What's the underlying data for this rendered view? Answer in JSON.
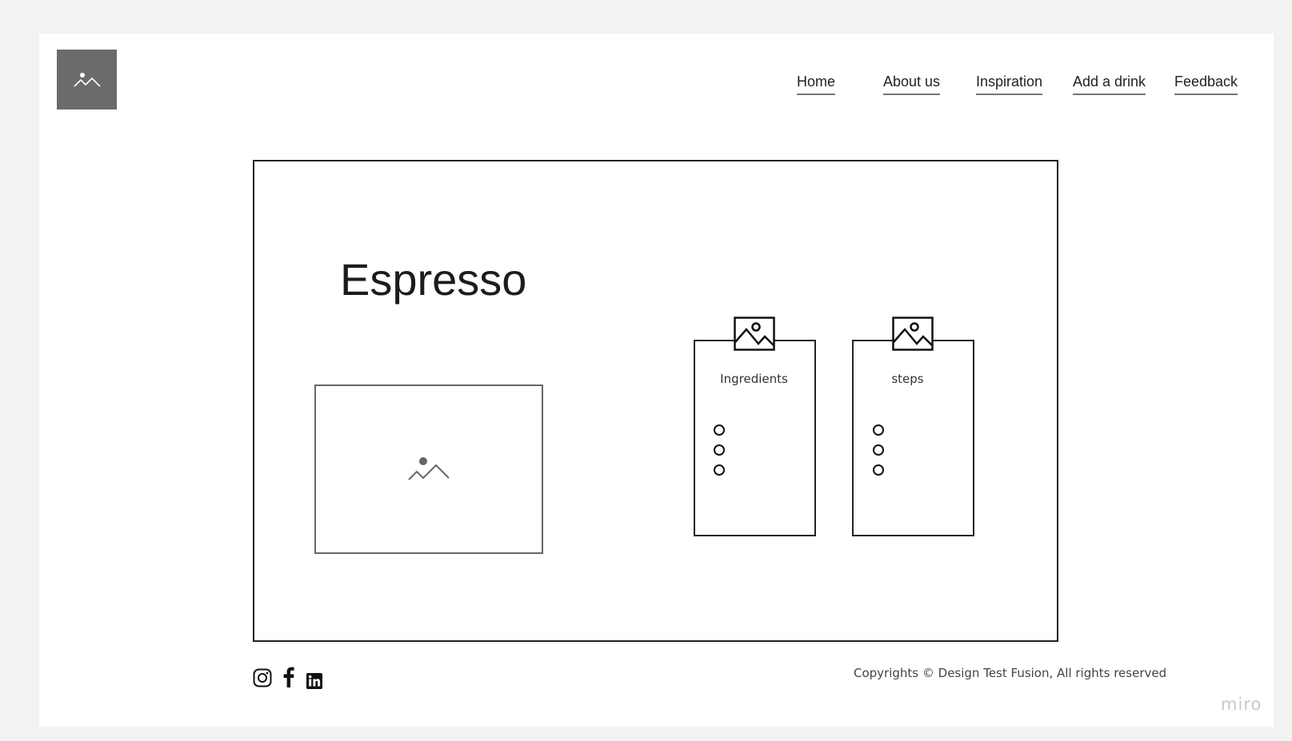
{
  "header": {
    "logo_icon": "image-placeholder-icon",
    "nav": [
      {
        "label": "Home"
      },
      {
        "label": "About us"
      },
      {
        "label": "Inspiration"
      },
      {
        "label": "Add a drink"
      },
      {
        "label": "Feedback"
      }
    ]
  },
  "main": {
    "title": "Espresso",
    "image_icon": "image-placeholder-icon",
    "cards": [
      {
        "label": "Ingredients",
        "icon": "picture-icon",
        "bullets": 3
      },
      {
        "label": "steps",
        "icon": "picture-icon",
        "bullets": 3
      }
    ]
  },
  "footer": {
    "social": [
      {
        "icon": "instagram-icon"
      },
      {
        "icon": "facebook-icon"
      },
      {
        "icon": "linkedin-icon"
      }
    ],
    "copyright": "Copyrights © Design Test Fusion, All rights reserved"
  },
  "watermark": "miro",
  "colors": {
    "canvas": "#f2f2f2",
    "logo_bg": "#6b6b6b",
    "border": "#222222",
    "nav_underline": "#777777"
  }
}
